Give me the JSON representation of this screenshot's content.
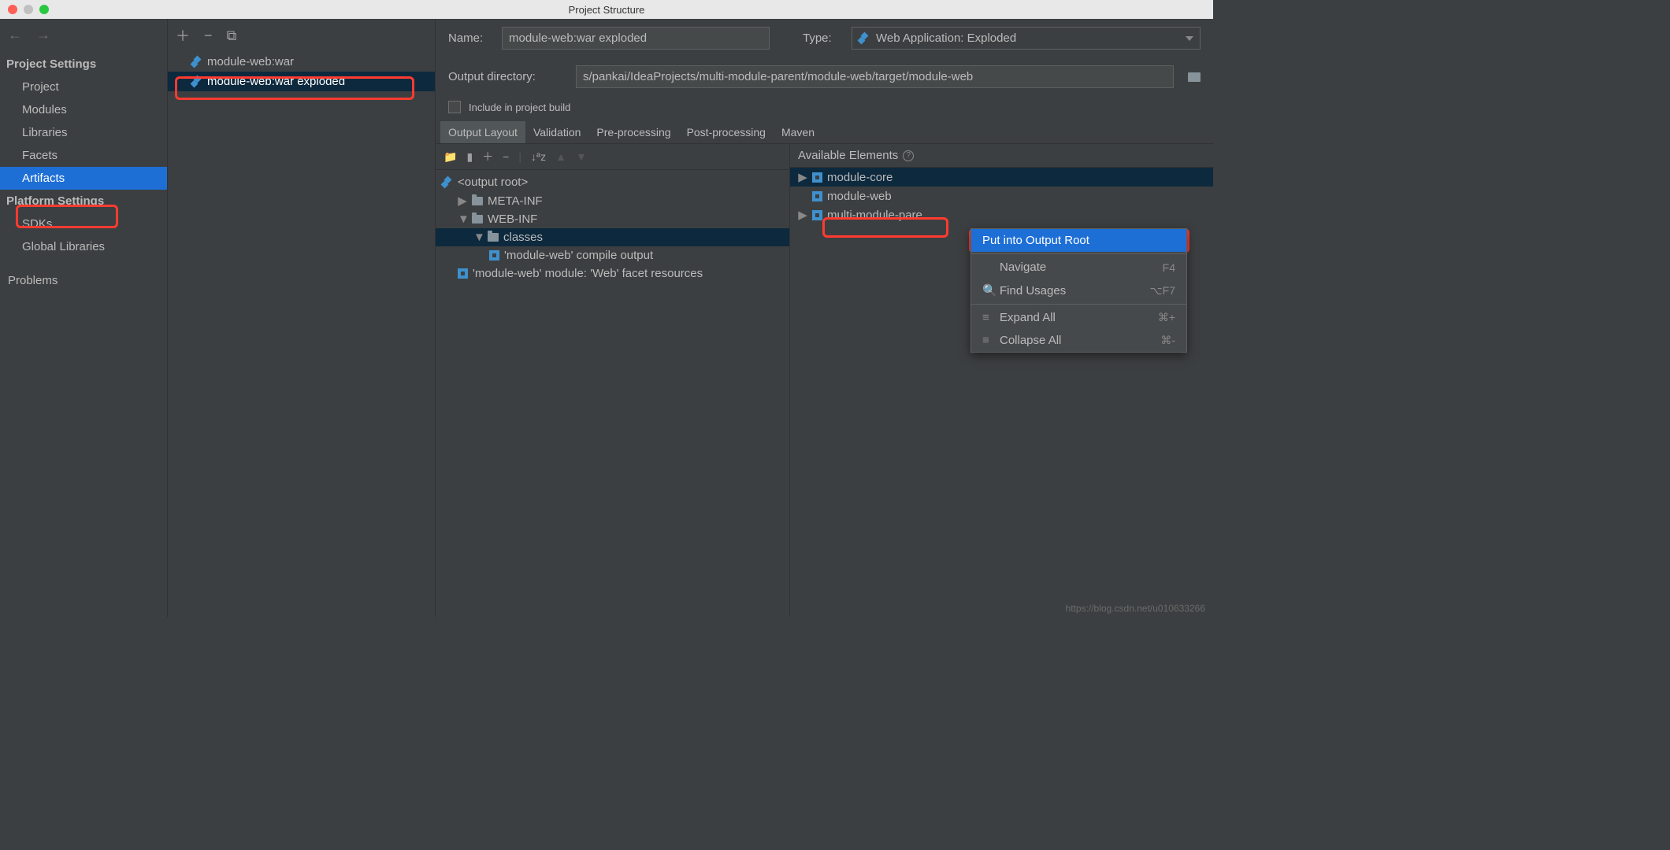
{
  "window": {
    "title": "Project Structure"
  },
  "sidebar": {
    "project_settings_label": "Project Settings",
    "platform_settings_label": "Platform Settings",
    "items": {
      "project": "Project",
      "modules": "Modules",
      "libraries": "Libraries",
      "facets": "Facets",
      "artifacts": "Artifacts",
      "sdks": "SDKs",
      "global_libraries": "Global Libraries",
      "problems": "Problems"
    }
  },
  "artifacts_list": [
    {
      "label": "module-web:war",
      "selected": false
    },
    {
      "label": "module-web:war exploded",
      "selected": true
    }
  ],
  "form": {
    "name_label": "Name:",
    "name_value": "module-web:war exploded",
    "type_label": "Type:",
    "type_value": "Web Application: Exploded",
    "output_dir_label": "Output directory:",
    "output_dir_value": "s/pankai/IdeaProjects/multi-module-parent/module-web/target/module-web",
    "include_build_label": "Include in project build"
  },
  "tabs": [
    "Output Layout",
    "Validation",
    "Pre-processing",
    "Post-processing",
    "Maven"
  ],
  "output_tree": {
    "root": "<output root>",
    "meta_inf": "META-INF",
    "web_inf": "WEB-INF",
    "classes": "classes",
    "compile_output": "'module-web' compile output",
    "facet_resources": "'module-web' module: 'Web' facet resources"
  },
  "available": {
    "header": "Available Elements",
    "items": [
      "module-core",
      "module-web",
      "multi-module-pare"
    ]
  },
  "context_menu": {
    "put_root": "Put into Output Root",
    "navigate": "Navigate",
    "navigate_key": "F4",
    "find_usages": "Find Usages",
    "find_usages_key": "⌥F7",
    "expand_all": "Expand All",
    "expand_all_key": "⌘+",
    "collapse_all": "Collapse All",
    "collapse_all_key": "⌘-"
  },
  "watermark": "https://blog.csdn.net/u010633266"
}
